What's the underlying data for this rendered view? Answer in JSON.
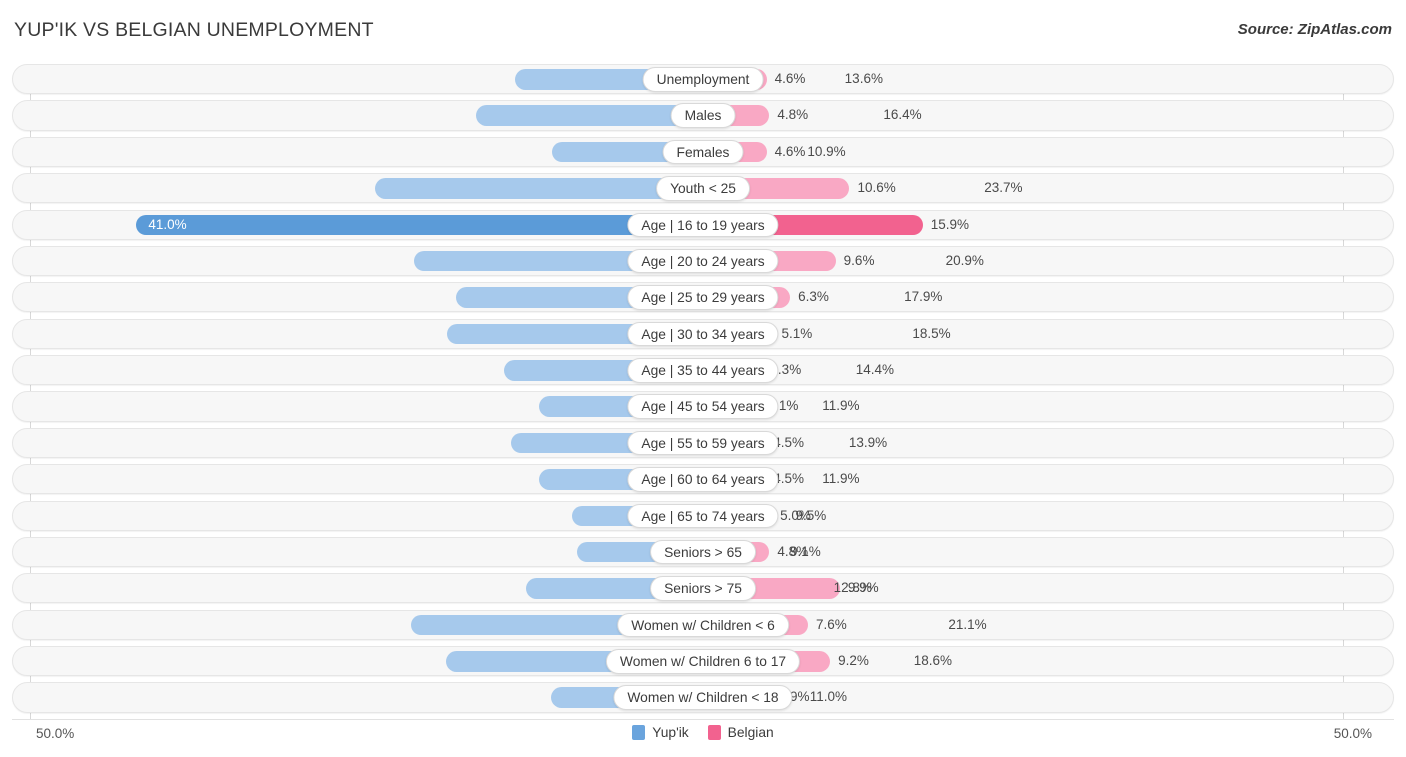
{
  "header": {
    "title": "YUP'IK VS BELGIAN UNEMPLOYMENT",
    "source": "Source: ZipAtlas.com"
  },
  "footer": {
    "axis_min": "50.0%",
    "axis_max": "50.0%",
    "legend": [
      {
        "label": "Yup'ik",
        "color": "#6aa4dd"
      },
      {
        "label": "Belgian",
        "color": "#f2628f"
      }
    ]
  },
  "colors": {
    "left_normal": "#a6c9ec",
    "left_max": "#5b9bd8",
    "right_normal": "#f9a8c4",
    "right_max": "#f2628f",
    "track": "#f7f7f7",
    "track_border": "#e6e6e6"
  },
  "chart_data": {
    "type": "bar",
    "subtype": "diverging-bar",
    "title": "YUP'IK VS BELGIAN UNEMPLOYMENT",
    "xlabel": "",
    "ylabel": "",
    "axis_max_percent": 50.0,
    "grid": false,
    "legend_position": "bottom-center",
    "series": [
      {
        "name": "Yup'ik",
        "side": "left",
        "color": "#a6c9ec",
        "values": [
          13.6,
          16.4,
          10.9,
          23.7,
          41.0,
          20.9,
          17.9,
          18.5,
          14.4,
          11.9,
          13.9,
          11.9,
          9.5,
          9.1,
          12.8,
          21.1,
          18.6,
          11.0
        ],
        "labels": [
          "13.6%",
          "16.4%",
          "10.9%",
          "23.7%",
          "41.0%",
          "20.9%",
          "17.9%",
          "18.5%",
          "14.4%",
          "11.9%",
          "13.9%",
          "11.9%",
          "9.5%",
          "9.1%",
          "12.8%",
          "21.1%",
          "18.6%",
          "11.0%"
        ]
      },
      {
        "name": "Belgian",
        "side": "right",
        "color": "#f9a8c4",
        "values": [
          4.6,
          4.8,
          4.6,
          10.6,
          15.9,
          9.6,
          6.3,
          5.1,
          4.3,
          4.1,
          4.5,
          4.5,
          5.0,
          4.8,
          9.9,
          7.6,
          9.2,
          4.9
        ],
        "labels": [
          "4.6%",
          "4.8%",
          "4.6%",
          "10.6%",
          "15.9%",
          "9.6%",
          "6.3%",
          "5.1%",
          "4.3%",
          "4.1%",
          "4.5%",
          "4.5%",
          "5.0%",
          "4.8%",
          "9.9%",
          "7.6%",
          "9.2%",
          "4.9%"
        ]
      }
    ],
    "categories": [
      "Unemployment",
      "Males",
      "Females",
      "Youth < 25",
      "Age | 16 to 19 years",
      "Age | 20 to 24 years",
      "Age | 25 to 29 years",
      "Age | 30 to 34 years",
      "Age | 35 to 44 years",
      "Age | 45 to 54 years",
      "Age | 55 to 59 years",
      "Age | 60 to 64 years",
      "Age | 65 to 74 years",
      "Seniors > 65",
      "Seniors > 75",
      "Women w/ Children < 6",
      "Women w/ Children 6 to 17",
      "Women w/ Children < 18"
    ]
  },
  "rows": [
    {
      "label": "Unemployment",
      "left_value": 13.6,
      "left_label": "13.6%",
      "right_value": 4.6,
      "right_label": "4.6%",
      "left_max": false,
      "right_max": false
    },
    {
      "label": "Males",
      "left_value": 16.4,
      "left_label": "16.4%",
      "right_value": 4.8,
      "right_label": "4.8%",
      "left_max": false,
      "right_max": false
    },
    {
      "label": "Females",
      "left_value": 10.9,
      "left_label": "10.9%",
      "right_value": 4.6,
      "right_label": "4.6%",
      "left_max": false,
      "right_max": false
    },
    {
      "label": "Youth < 25",
      "left_value": 23.7,
      "left_label": "23.7%",
      "right_value": 10.6,
      "right_label": "10.6%",
      "left_max": false,
      "right_max": false
    },
    {
      "label": "Age | 16 to 19 years",
      "left_value": 41.0,
      "left_label": "41.0%",
      "right_value": 15.9,
      "right_label": "15.9%",
      "left_max": true,
      "right_max": true
    },
    {
      "label": "Age | 20 to 24 years",
      "left_value": 20.9,
      "left_label": "20.9%",
      "right_value": 9.6,
      "right_label": "9.6%",
      "left_max": false,
      "right_max": false
    },
    {
      "label": "Age | 25 to 29 years",
      "left_value": 17.9,
      "left_label": "17.9%",
      "right_value": 6.3,
      "right_label": "6.3%",
      "left_max": false,
      "right_max": false
    },
    {
      "label": "Age | 30 to 34 years",
      "left_value": 18.5,
      "left_label": "18.5%",
      "right_value": 5.1,
      "right_label": "5.1%",
      "left_max": false,
      "right_max": false
    },
    {
      "label": "Age | 35 to 44 years",
      "left_value": 14.4,
      "left_label": "14.4%",
      "right_value": 4.3,
      "right_label": "4.3%",
      "left_max": false,
      "right_max": false
    },
    {
      "label": "Age | 45 to 54 years",
      "left_value": 11.9,
      "left_label": "11.9%",
      "right_value": 4.1,
      "right_label": "4.1%",
      "left_max": false,
      "right_max": false
    },
    {
      "label": "Age | 55 to 59 years",
      "left_value": 13.9,
      "left_label": "13.9%",
      "right_value": 4.5,
      "right_label": "4.5%",
      "left_max": false,
      "right_max": false
    },
    {
      "label": "Age | 60 to 64 years",
      "left_value": 11.9,
      "left_label": "11.9%",
      "right_value": 4.5,
      "right_label": "4.5%",
      "left_max": false,
      "right_max": false
    },
    {
      "label": "Age | 65 to 74 years",
      "left_value": 9.5,
      "left_label": "9.5%",
      "right_value": 5.0,
      "right_label": "5.0%",
      "left_max": false,
      "right_max": false
    },
    {
      "label": "Seniors > 65",
      "left_value": 9.1,
      "left_label": "9.1%",
      "right_value": 4.8,
      "right_label": "4.8%",
      "left_max": false,
      "right_max": false
    },
    {
      "label": "Seniors > 75",
      "left_value": 12.8,
      "left_label": "12.8%",
      "right_value": 9.9,
      "right_label": "9.9%",
      "left_max": false,
      "right_max": false
    },
    {
      "label": "Women w/ Children < 6",
      "left_value": 21.1,
      "left_label": "21.1%",
      "right_value": 7.6,
      "right_label": "7.6%",
      "left_max": false,
      "right_max": false
    },
    {
      "label": "Women w/ Children 6 to 17",
      "left_value": 18.6,
      "left_label": "18.6%",
      "right_value": 9.2,
      "right_label": "9.2%",
      "left_max": false,
      "right_max": false
    },
    {
      "label": "Women w/ Children < 18",
      "left_value": 11.0,
      "left_label": "11.0%",
      "right_value": 4.9,
      "right_label": "4.9%",
      "left_max": false,
      "right_max": false
    }
  ]
}
